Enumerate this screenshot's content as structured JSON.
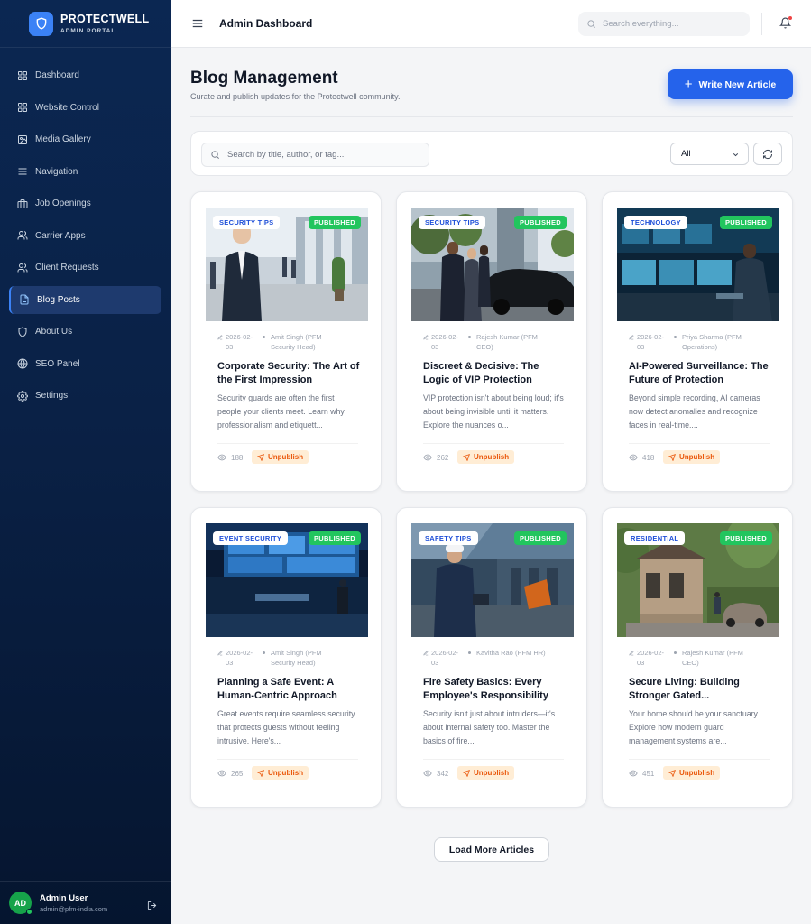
{
  "brand": {
    "name": "PROTECTWELL",
    "subtitle": "ADMIN PORTAL"
  },
  "nav": [
    {
      "label": "Dashboard",
      "icon": "grid-icon",
      "active": false
    },
    {
      "label": "Website Control",
      "icon": "grid-icon",
      "active": false
    },
    {
      "label": "Media Gallery",
      "icon": "image-icon",
      "active": false
    },
    {
      "label": "Navigation",
      "icon": "menu-icon",
      "active": false
    },
    {
      "label": "Job Openings",
      "icon": "briefcase-icon",
      "active": false
    },
    {
      "label": "Carrier Apps",
      "icon": "users-icon",
      "active": false
    },
    {
      "label": "Client Requests",
      "icon": "users-icon",
      "active": false
    },
    {
      "label": "Blog Posts",
      "icon": "document-icon",
      "active": true
    },
    {
      "label": "About Us",
      "icon": "shield-icon",
      "active": false
    },
    {
      "label": "SEO Panel",
      "icon": "globe-icon",
      "active": false
    },
    {
      "label": "Settings",
      "icon": "gear-icon",
      "active": false
    }
  ],
  "user": {
    "initials": "AD",
    "name": "Admin User",
    "email": "admin@pfm-india.com"
  },
  "topbar": {
    "title": "Admin Dashboard",
    "search_placeholder": "Search everything..."
  },
  "page": {
    "title": "Blog Management",
    "subtitle": "Curate and publish updates for the Protectwell community.",
    "write_button": "Write New Article",
    "search_placeholder": "Search by title, author, or tag...",
    "filter_value": "All",
    "load_more": "Load More Articles"
  },
  "colors": {
    "primary": "#2563eb",
    "published": "#22c55e",
    "unpublish_bg": "#ffedd5",
    "unpublish_text": "#ea580c",
    "sidebar": "#0a2146"
  },
  "posts": [
    {
      "category": "SECURITY TIPS",
      "status": "PUBLISHED",
      "date": "2026-02-03",
      "author": "Amit Singh (PFM Security Head)",
      "title": "Corporate Security: The Art of the First Impression",
      "excerpt": "Security guards are often the first people your clients meet. Learn why professionalism and etiquett...",
      "views": "188",
      "action": "Unpublish"
    },
    {
      "category": "SECURITY TIPS",
      "status": "PUBLISHED",
      "date": "2026-02-03",
      "author": "Rajesh Kumar (PFM CEO)",
      "title": "Discreet & Decisive: The Logic of VIP Protection",
      "excerpt": "VIP protection isn't about being loud; it's about being invisible until it matters. Explore the nuances o...",
      "views": "262",
      "action": "Unpublish"
    },
    {
      "category": "TECHNOLOGY",
      "status": "PUBLISHED",
      "date": "2026-02-03",
      "author": "Priya Sharma (PFM Operations)",
      "title": "AI-Powered Surveillance: The Future of Protection",
      "excerpt": "Beyond simple recording, AI cameras now detect anomalies and recognize faces in real-time....",
      "views": "418",
      "action": "Unpublish"
    },
    {
      "category": "EVENT SECURITY",
      "status": "PUBLISHED",
      "date": "2026-02-03",
      "author": "Amit Singh (PFM Security Head)",
      "title": "Planning a Safe Event: A Human-Centric Approach",
      "excerpt": "Great events require seamless security that protects guests without feeling intrusive. Here's...",
      "views": "265",
      "action": "Unpublish"
    },
    {
      "category": "SAFETY TIPS",
      "status": "PUBLISHED",
      "date": "2026-02-03",
      "author": "Kavitha Rao (PFM HR)",
      "title": "Fire Safety Basics: Every Employee's Responsibility",
      "excerpt": "Security isn't just about intruders—it's about internal safety too. Master the basics of fire...",
      "views": "342",
      "action": "Unpublish"
    },
    {
      "category": "RESIDENTIAL",
      "status": "PUBLISHED",
      "date": "2026-02-03",
      "author": "Rajesh Kumar (PFM CEO)",
      "title": "Secure Living: Building Stronger Gated...",
      "excerpt": "Your home should be your sanctuary. Explore how modern guard management systems are...",
      "views": "451",
      "action": "Unpublish"
    }
  ]
}
